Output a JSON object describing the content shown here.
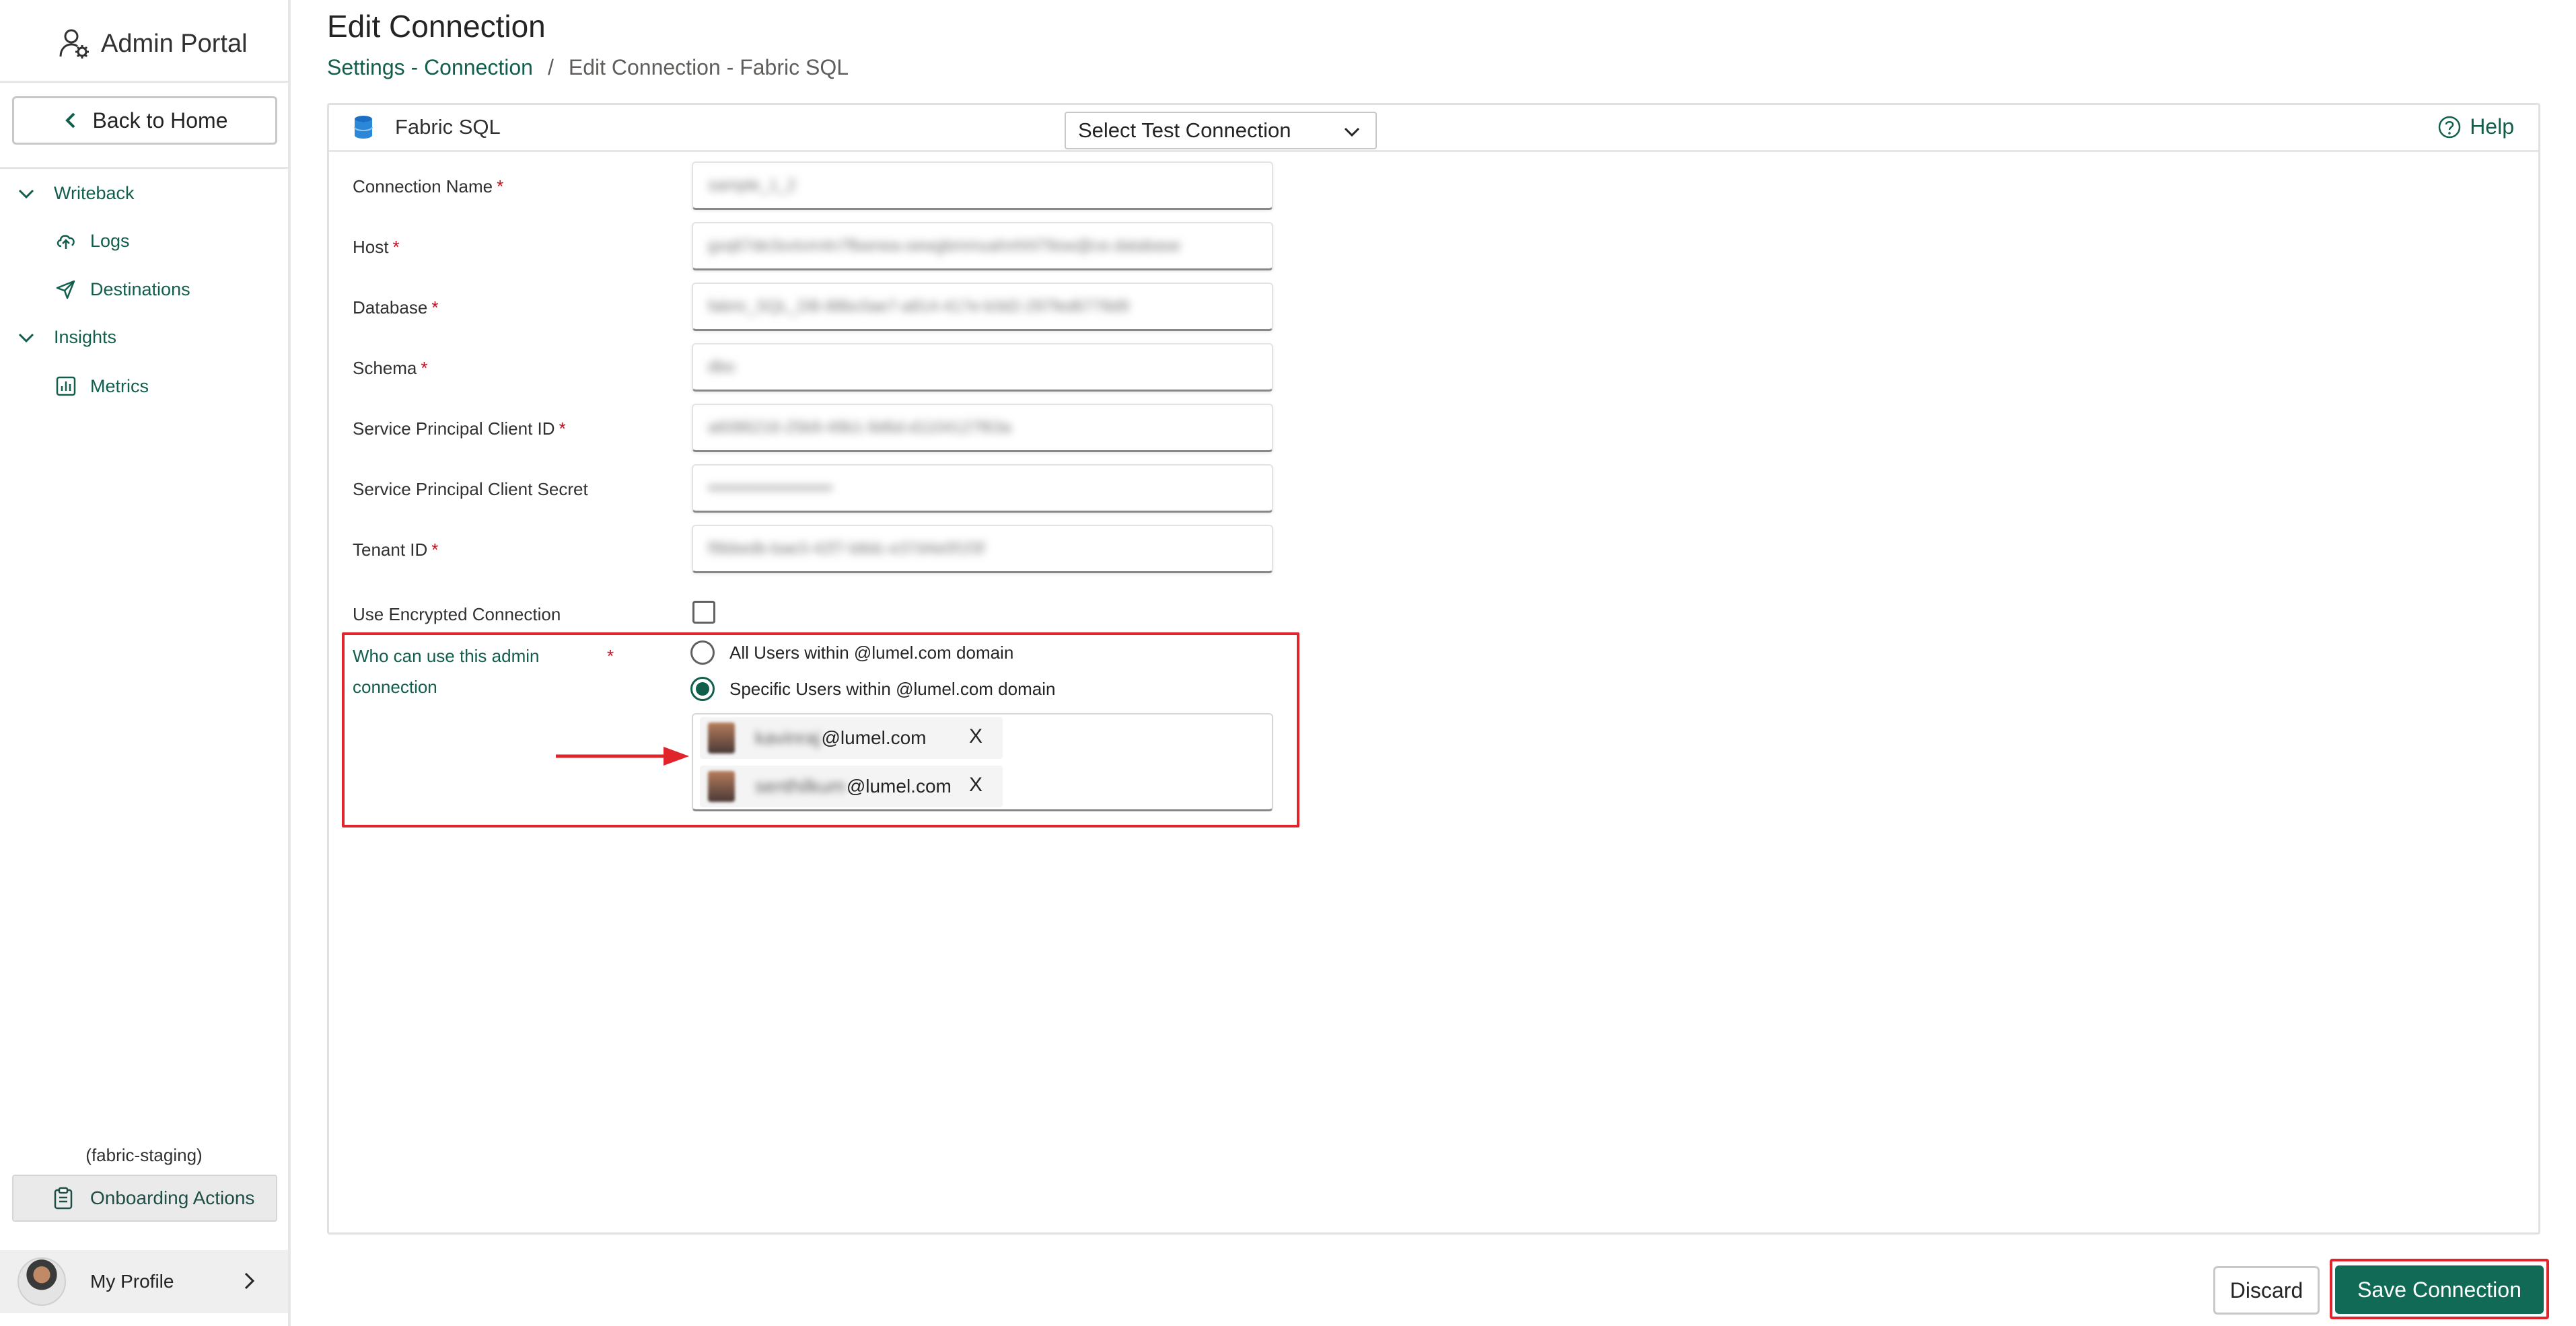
{
  "app": {
    "title": "Admin Portal"
  },
  "sidebar": {
    "back_label": "Back to Home",
    "groups": [
      {
        "label": "Writeback",
        "items": [
          {
            "label": "Logs"
          },
          {
            "label": "Destinations"
          }
        ]
      },
      {
        "label": "Insights",
        "items": [
          {
            "label": "Metrics"
          }
        ]
      }
    ],
    "environment": "(fabric-staging)",
    "onboarding_label": "Onboarding Actions",
    "profile_label": "My Profile"
  },
  "page": {
    "title": "Edit Connection",
    "breadcrumb": {
      "parent": "Settings - Connection",
      "separator": "/",
      "current": "Edit Connection - Fabric SQL"
    }
  },
  "panel": {
    "db_name": "Fabric SQL",
    "test_connection_placeholder": "Select Test Connection",
    "help_label": "Help"
  },
  "form": {
    "required_mark": "*",
    "fields": [
      {
        "label": "Connection Name",
        "value": "sample_1_2"
      },
      {
        "label": "Host",
        "value": "gxq67de3svtvm4n7fbwnea-oewgbmmuahnhhl79ow@ce.database"
      },
      {
        "label": "Database",
        "value": "fabric_SQL_DB-88bc0ae7-a814-417e-b3d2-297fed6778d9"
      },
      {
        "label": "Schema",
        "value": "dbo"
      },
      {
        "label": "Service Principal Client ID",
        "value": "a6086216-25b9-49b1-9d6d-d1104127f63a"
      },
      {
        "label": "Service Principal Client Secret",
        "value": "••••••••••••••••••••••"
      },
      {
        "label": "Tenant ID",
        "value": "f9bbedb-bae3-42f7-b8dc-e37d4e0f1f3f"
      }
    ],
    "encrypted_label": "Use Encrypted Connection",
    "who_label": "Who can use this admin connection",
    "radio_all": "All Users within @lumel.com domain",
    "radio_specific": "Specific Users within @lumel.com domain",
    "users": [
      {
        "name": "kavinraj",
        "domain": "@lumel.com",
        "remove": "X"
      },
      {
        "name": "senthilkum",
        "domain": "@lumel.com",
        "remove": "X"
      }
    ]
  },
  "footer": {
    "discard_label": "Discard",
    "save_label": "Save Connection"
  }
}
